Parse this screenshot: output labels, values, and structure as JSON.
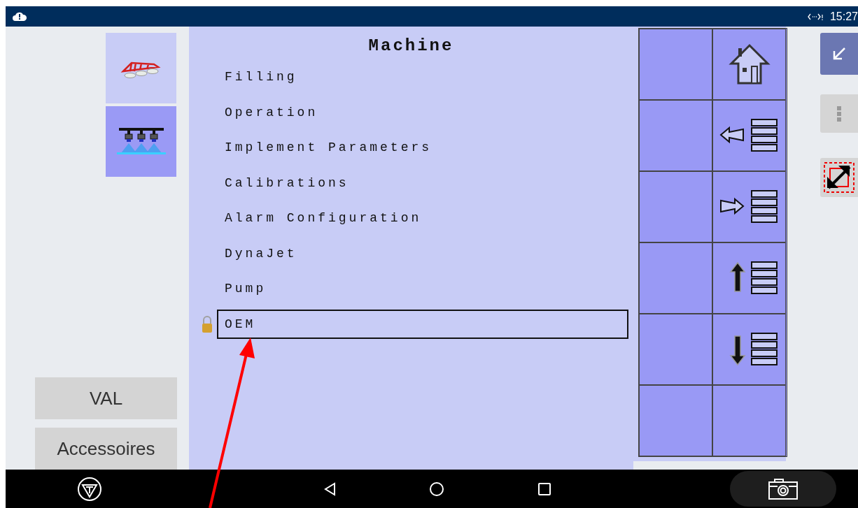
{
  "status_bar": {
    "time": "15:27"
  },
  "side_buttons": [
    {
      "label": "VAL"
    },
    {
      "label": "Accessoires"
    }
  ],
  "menu": {
    "title": "Machine",
    "items": [
      {
        "label": "Filling",
        "selected": false,
        "locked": false
      },
      {
        "label": "Operation",
        "selected": false,
        "locked": false
      },
      {
        "label": "Implement Parameters",
        "selected": false,
        "locked": false
      },
      {
        "label": "Calibrations",
        "selected": false,
        "locked": false
      },
      {
        "label": "Alarm Configuration",
        "selected": false,
        "locked": false
      },
      {
        "label": "DynaJet",
        "selected": false,
        "locked": false
      },
      {
        "label": "Pump",
        "selected": false,
        "locked": false
      },
      {
        "label": "OEM",
        "selected": true,
        "locked": true
      }
    ]
  },
  "softkeys": [
    {
      "kind": "empty"
    },
    {
      "kind": "home"
    },
    {
      "kind": "empty"
    },
    {
      "kind": "back"
    },
    {
      "kind": "empty"
    },
    {
      "kind": "enter"
    },
    {
      "kind": "empty"
    },
    {
      "kind": "up"
    },
    {
      "kind": "empty"
    },
    {
      "kind": "down"
    },
    {
      "kind": "empty"
    },
    {
      "kind": "empty"
    }
  ]
}
